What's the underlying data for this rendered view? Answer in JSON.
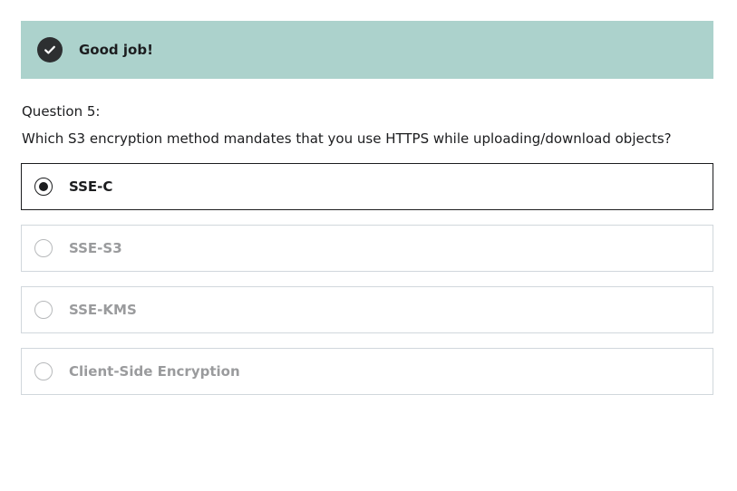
{
  "feedback": {
    "icon": "check-circle-icon",
    "message": "Good job!",
    "color": "#acd2cc"
  },
  "question": {
    "number": "Question 5:",
    "text": "Which S3 encryption method mandates that you use HTTPS while uploading/download objects?"
  },
  "options": [
    {
      "label": "SSE-C",
      "selected": true
    },
    {
      "label": "SSE-S3",
      "selected": false
    },
    {
      "label": "SSE-KMS",
      "selected": false
    },
    {
      "label": "Client-Side Encryption",
      "selected": false
    }
  ]
}
